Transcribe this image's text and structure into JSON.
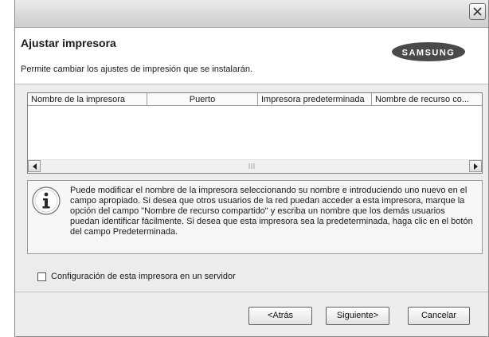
{
  "dialog": {
    "title": "Ajustar impresora",
    "subtitle": "Permite cambiar los ajustes de impresión que se instalarán.",
    "logo_text": "SAMSUNG"
  },
  "table": {
    "columns": [
      "Nombre de la impresora",
      "Puerto",
      "Impresora predeterminada",
      "Nombre de recurso co..."
    ],
    "rows": []
  },
  "info": {
    "text": "Puede modificar el nombre de la impresora seleccionando su nombre e introduciendo uno nuevo en el campo apropiado. Si desea que otros usuarios de la red puedan acceder a esta impresora, marque la opción del campo \"Nombre de recurso compartido\" y escriba un nombre que los demás usuarios puedan identificar fácilmente. Si desea que esta impresora sea la predeterminada, haga clic en el botón del campo Predeterminada."
  },
  "server_option": {
    "label": "Configuración de esta impresora en un servidor",
    "checked": false
  },
  "buttons": {
    "back": "<Atrás",
    "next": "Siguiente>",
    "cancel": "Cancelar"
  },
  "colors": {
    "dialog_bg": "#ececec",
    "header_bg": "#ffffff",
    "logo_bg": "#4a4a4a"
  }
}
